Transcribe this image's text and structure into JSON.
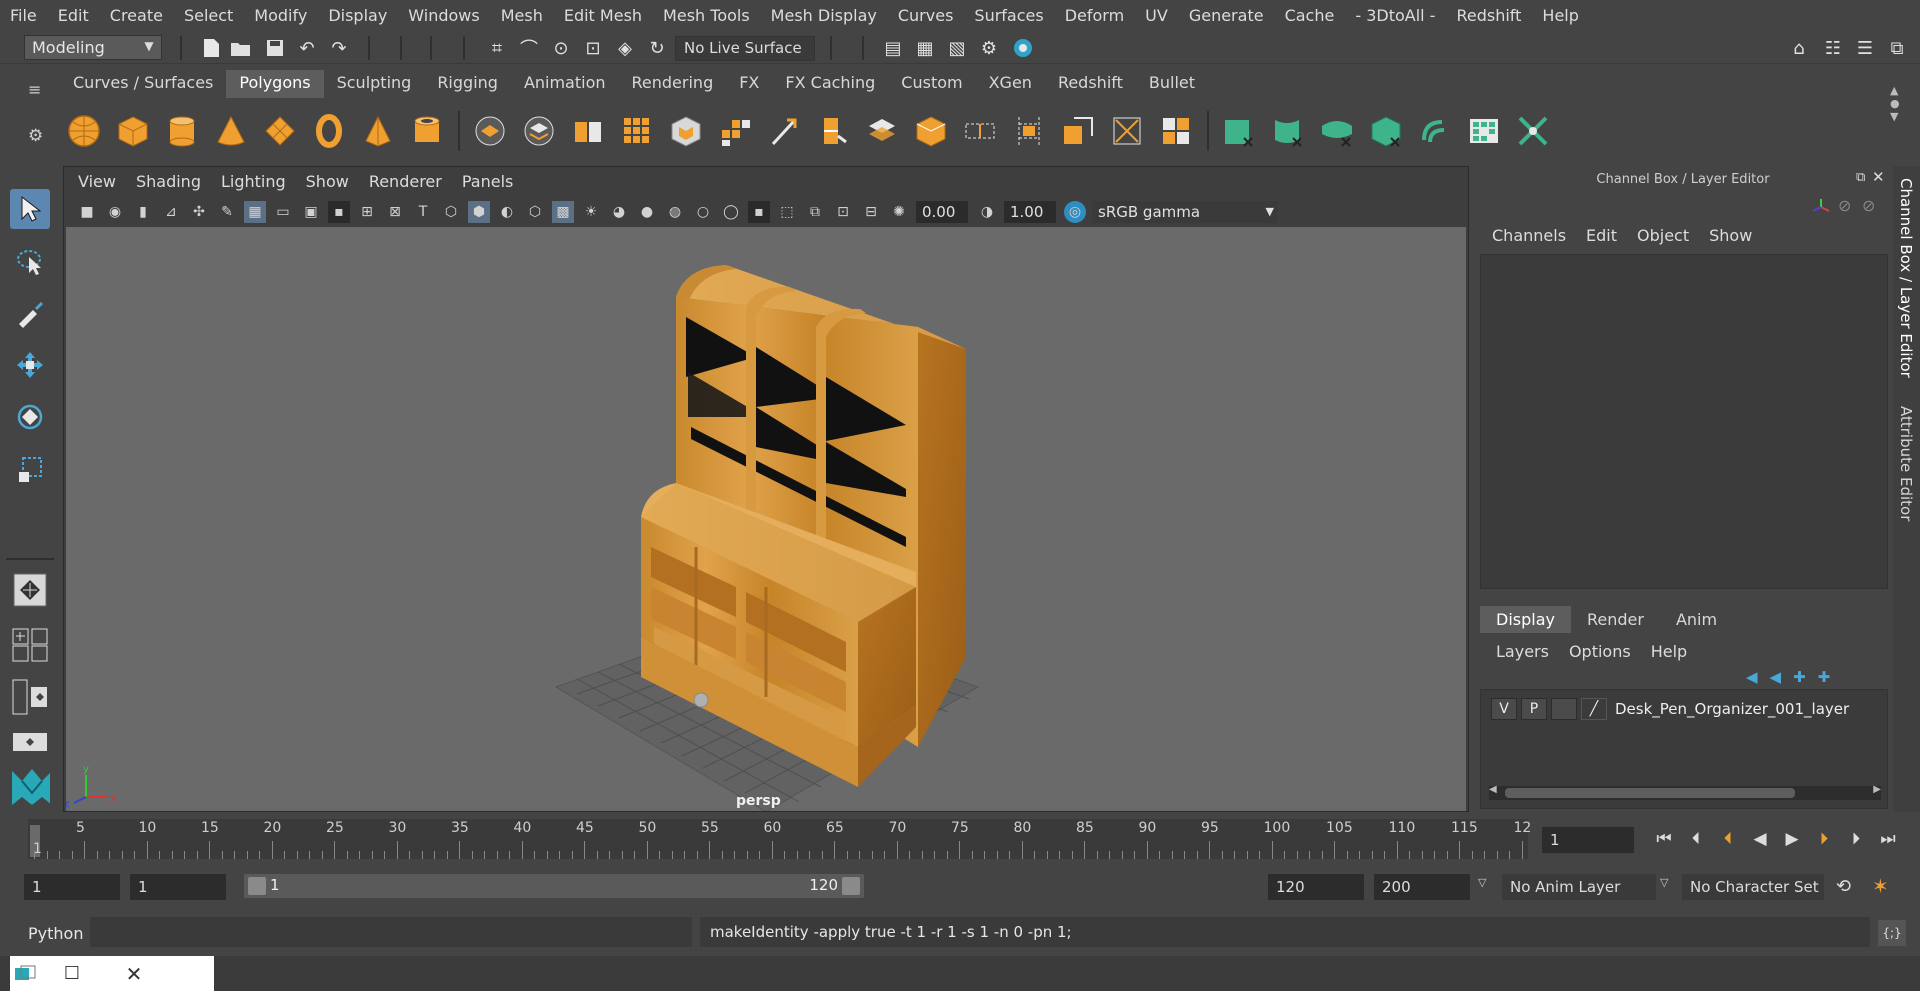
{
  "menubar": [
    "File",
    "Edit",
    "Create",
    "Select",
    "Modify",
    "Display",
    "Windows",
    "Mesh",
    "Edit Mesh",
    "Mesh Tools",
    "Mesh Display",
    "Curves",
    "Surfaces",
    "Deform",
    "UV",
    "Generate",
    "Cache",
    "- 3DtoAll -",
    "Redshift",
    "Help"
  ],
  "status": {
    "mode": "Modeling",
    "live_surface": "No Live Surface"
  },
  "shelf": {
    "tabs": [
      "Curves / Surfaces",
      "Polygons",
      "Sculpting",
      "Rigging",
      "Animation",
      "Rendering",
      "FX",
      "FX Caching",
      "Custom",
      "XGen",
      "Redshift",
      "Bullet"
    ],
    "active_tab": "Polygons"
  },
  "viewport": {
    "menu": [
      "View",
      "Shading",
      "Lighting",
      "Show",
      "Renderer",
      "Panels"
    ],
    "exposure": "0.00",
    "gamma": "1.00",
    "colorspace": "sRGB gamma",
    "camera_label": "persp"
  },
  "right_panel": {
    "title": "Channel Box / Layer Editor",
    "menu": [
      "Channels",
      "Edit",
      "Object",
      "Show"
    ],
    "tabs": [
      "Display",
      "Render",
      "Anim"
    ],
    "active_tab": "Display",
    "layer_menu": [
      "Layers",
      "Options",
      "Help"
    ],
    "layer": {
      "v": "V",
      "p": "P",
      "name": "Desk_Pen_Organizer_001_layer"
    },
    "side_tabs": [
      "Channel Box / Layer Editor",
      "Attribute Editor"
    ]
  },
  "timeline": {
    "ticks": [
      "5",
      "10",
      "15",
      "20",
      "25",
      "30",
      "35",
      "40",
      "45",
      "50",
      "55",
      "60",
      "65",
      "70",
      "75",
      "80",
      "85",
      "90",
      "95",
      "100",
      "105",
      "110",
      "115",
      "12"
    ],
    "start_marker": "1",
    "current_frame": "1"
  },
  "range": {
    "start": "1",
    "playback_start": "1",
    "slider_start": "1",
    "slider_end": "120",
    "playback_end": "120",
    "end": "200",
    "anim_layer": "No Anim Layer",
    "character_set": "No Character Set"
  },
  "command": {
    "language": "Python",
    "result": "makeIdentity -apply true -t 1 -r 1 -s 1 -n 0 -pn 1;"
  },
  "colors": {
    "accent_blue": "#5b87b0",
    "shelf_orange": "#f0a030",
    "shelf_teal": "#3fb38a"
  }
}
